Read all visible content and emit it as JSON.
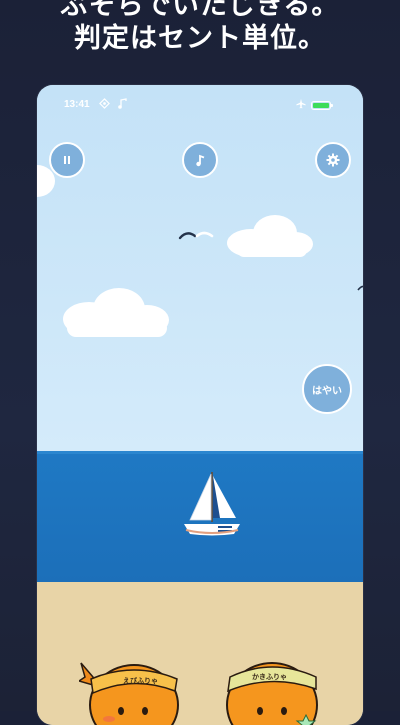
{
  "headline": {
    "line1": "ぶそらでいたじきる。",
    "line2": "判定はセント単位。"
  },
  "status_bar": {
    "time": "13:41"
  },
  "controls": {
    "speed_label": "はやい"
  },
  "characters": [
    {
      "headband_text": "えびふりゃ"
    },
    {
      "headband_text": "かきふりゃ"
    }
  ],
  "colors": {
    "accent_button": "#7fb0db",
    "sea": "#1f79c4",
    "sand": "#e8d4a7",
    "battery": "#3ddc5a"
  }
}
